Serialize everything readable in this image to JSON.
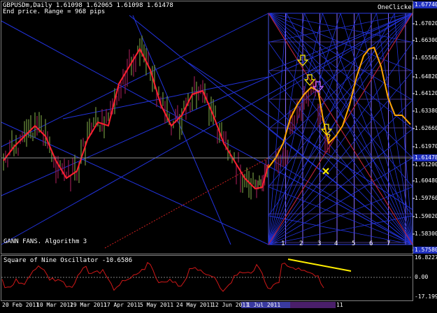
{
  "header": {
    "symbol_line": "GBPUSDm,Daily  1.61098 1.62065 1.61098 1.61478",
    "info_line": "End price. Range = 968 pips",
    "oneclicker": "OneClicker"
  },
  "indicator_label": "GANN FANS. Algorithm 3",
  "oscillator": {
    "title": "Square of Nine Oscillator -10.6586",
    "levels": [
      "16.8227",
      "0.00",
      "-17.1994"
    ]
  },
  "price_axis": [
    "1.67740",
    "1.67020",
    "1.66300",
    "1.65560",
    "1.64820",
    "1.64120",
    "1.63380",
    "1.62660",
    "1.61970",
    "1.61478",
    "1.61200",
    "1.60480",
    "1.59760",
    "1.59020",
    "1.58300",
    "1.57580"
  ],
  "date_axis": [
    "20 Feb 2011",
    "10 Mar 2011",
    "29 Mar 2011",
    "17 Apr 2011",
    "5 May 2011",
    "24 May 2011",
    "12 Jun 2011",
    "1 Jul 2011",
    "11"
  ],
  "gann_numbers": [
    "1",
    "2",
    "3",
    "4",
    "5",
    "6",
    "7"
  ],
  "question_mark": "?",
  "colors": {
    "background": "#000000",
    "price_bars": "#8b1a4a",
    "moving_average": "#ff2030",
    "forecast": "#ffa500",
    "gann_lines": "#2233dd",
    "grid_purple": "#8a6aff",
    "red_diagonal": "#d02020",
    "yellow_arrow": "#ffee00"
  },
  "chart_data": {
    "type": "line",
    "title": "GBPUSDm,Daily",
    "ylim": [
      1.5758,
      1.6774
    ],
    "current_price": 1.61478,
    "series": [
      {
        "name": "price",
        "x": [
          "20 Feb 2011",
          "10 Mar 2011",
          "29 Mar 2011",
          "17 Apr 2011",
          "5 May 2011",
          "24 May 2011",
          "12 Jun 2011",
          "1 Jul 2011"
        ],
        "values": [
          1.615,
          1.61,
          1.625,
          1.66,
          1.645,
          1.635,
          1.625,
          1.6
        ]
      }
    ]
  }
}
